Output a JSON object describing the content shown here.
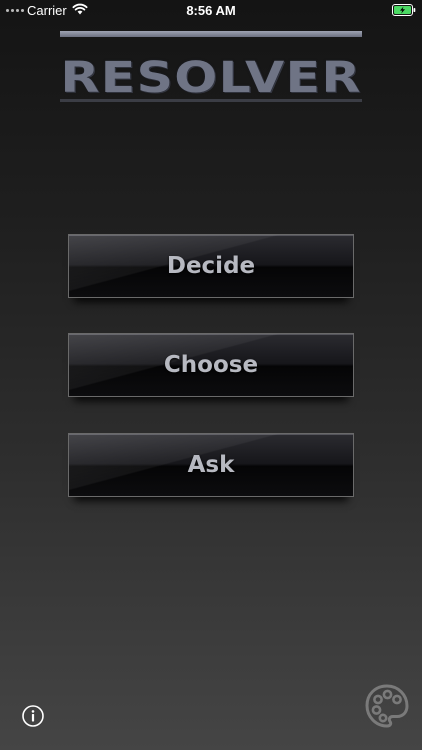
{
  "status_bar": {
    "carrier": "Carrier",
    "time": "8:56 AM",
    "icons": [
      "signal-dots-icon",
      "wifi-icon",
      "battery-charging-icon"
    ]
  },
  "app": {
    "title": "RESOLVER"
  },
  "buttons": {
    "decide": "Decide",
    "choose": "Choose",
    "ask": "Ask"
  },
  "footer": {
    "icons": [
      "info-icon",
      "palette-icon"
    ]
  },
  "colors": {
    "background_top": "#141414",
    "background_bottom": "#454545",
    "title": "#6f7485",
    "button_text": "#b7b9c1",
    "battery_fill": "#4cd964"
  }
}
